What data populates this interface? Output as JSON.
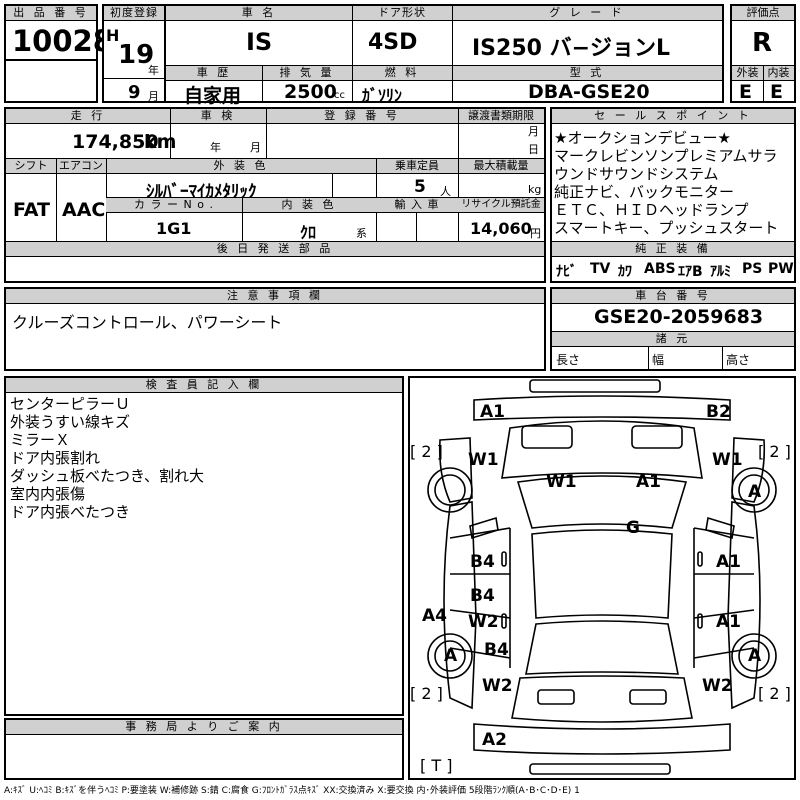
{
  "lot": {
    "label": "出 品 番 号",
    "value": "10028"
  },
  "reg": {
    "label": "初度登録",
    "era": "H",
    "year": "19",
    "year_unit": "年",
    "month": "9",
    "month_unit": "月"
  },
  "car": {
    "label": "車 名",
    "value": "IS"
  },
  "door": {
    "label": "ドア形状",
    "value": "4SD"
  },
  "grade": {
    "label": "グ レ ー ド",
    "value": "IS250 バ−ジョンL"
  },
  "score": {
    "label": "評価点",
    "value": "R",
    "ext_label": "外装",
    "ext": "E",
    "int_label": "内装",
    "int": "E"
  },
  "history": {
    "label": "車 歴",
    "value": "自家用"
  },
  "displacement": {
    "label": "排 気 量",
    "value": "2500",
    "unit": "cc"
  },
  "fuel": {
    "label": "燃 料",
    "value": "ｶﾞｿﾘﾝ"
  },
  "model": {
    "label": "型 式",
    "value": "DBA-GSE20"
  },
  "mileage": {
    "label": "走 行",
    "value": "174,850",
    "unit": "km"
  },
  "inspection": {
    "label": "車 検",
    "year_unit": "年",
    "month_unit": "月"
  },
  "regno": {
    "label": "登 録 番 号"
  },
  "transfer": {
    "label": "譲渡書類期限",
    "month_unit": "月",
    "day_unit": "日"
  },
  "shift": {
    "label": "シフト",
    "value": "FAT"
  },
  "ac": {
    "label": "エアコン",
    "value": "AAC"
  },
  "exterior": {
    "label": "外 装 色",
    "value": "ｼﾙﾊﾞｰﾏｲｶﾒﾀﾘｯｸ"
  },
  "capacity": {
    "label": "乗車定員",
    "value": "5",
    "unit": "人"
  },
  "load": {
    "label": "最大積載量",
    "unit": "kg"
  },
  "colorno": {
    "label": "カ ラ ー N o .",
    "value": "1G1"
  },
  "interior": {
    "label": "内 装 色",
    "value": "ｸﾛ",
    "unit": "系"
  },
  "import": {
    "label": "輸 入 車"
  },
  "recycle": {
    "label": "リサイクル預託金",
    "value": "14,060",
    "unit": "円"
  },
  "later": {
    "label": "後 日 発 送 部 品"
  },
  "sales": {
    "label": "セ ー ル ス ポ イ ン ト",
    "lines": [
      "★オークションデビュー★",
      "マークレビンソンプレミアムサラ",
      "ウンドサウンドシステム",
      "純正ナビ、バックモニター",
      "ＥＴＣ、ＨＩＤヘッドランプ",
      "スマートキー、プッシュスタート"
    ]
  },
  "equip": {
    "label": "純 正 装 備",
    "items": [
      "ﾅﾋﾞ",
      "TV",
      "ｶﾜ",
      "ABS",
      "ｴｱB",
      "ｱﾙﾐ",
      "PS",
      "PW"
    ]
  },
  "notes": {
    "label": "注 意 事 項 欄",
    "value": "クルーズコントロール、パワーシート"
  },
  "chassis": {
    "label": "車 台 番 号",
    "value": "GSE20-2059683"
  },
  "dims": {
    "label": "諸 元",
    "length": "長さ",
    "width": "幅",
    "height": "高さ"
  },
  "inspector": {
    "label": "検 査 員 記 入 欄",
    "lines": [
      "センターピラーＵ",
      "外装うすい線キズ",
      "ミラーＸ",
      "ドア内張割れ",
      "ダッシュ板べたつき、割れ大",
      "室内内張傷",
      "ドア内張べたつき"
    ]
  },
  "office": {
    "label": "事 務 局 よ り ご 案 内"
  },
  "legend": "A:ｷｽﾞ U:ﾍｺﾐ B:ｷｽﾞを伴うﾍｺﾐ P:要塗装 W:補修跡 S:錆 C:腐食 G:ﾌﾛﾝﾄｶﾞﾗｽ点ｷｽﾞ XX:交換済み X:要交換 内･外装評価 5段階ﾗﾝｸ順(A･B･C･D･E) 1",
  "diagram": {
    "marks": [
      "A1",
      "B2",
      "W1",
      "W1",
      "A",
      "W1",
      "A1",
      "G",
      "B4",
      "A1",
      "B4",
      "W2",
      "A1",
      "A4",
      "A",
      "B4",
      "A",
      "W2",
      "W2",
      "A2"
    ],
    "brackets": [
      "[ 2 ]",
      "[ 2 ]",
      "[ 2 ]",
      "[ 2 ]",
      "[ T ]"
    ]
  }
}
